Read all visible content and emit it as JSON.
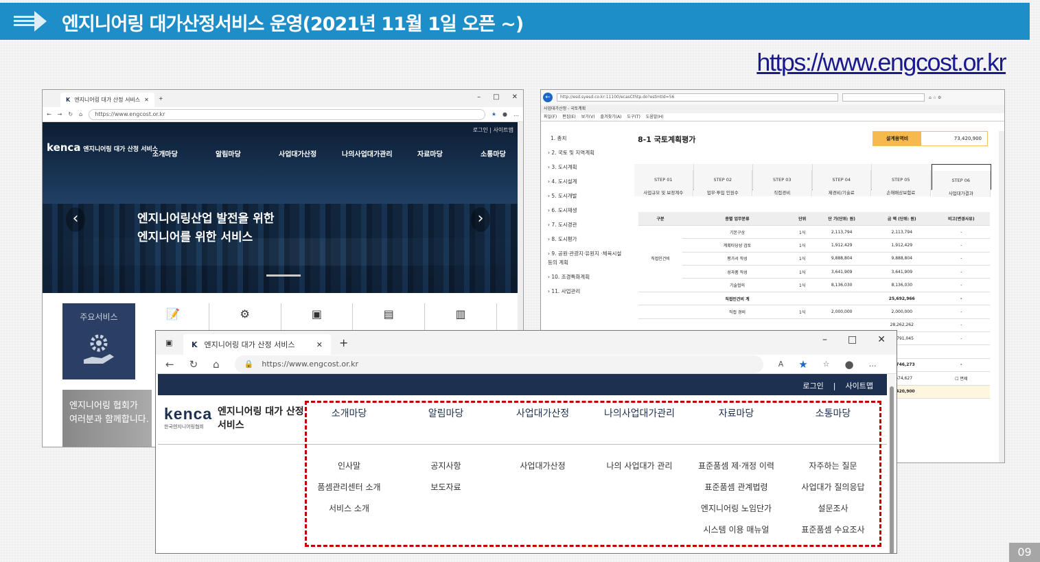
{
  "slide": {
    "title": "엔지니어링 대가산정서비스 운영(2021년 11월 1일 오픈 ~)",
    "url": "https://www.engcost.or.kr",
    "page_number": "09"
  },
  "win1": {
    "tab_title": "엔지니어링 대가 산정 서비스",
    "address": "https://www.engcost.or.kr",
    "login": "로그인 | 사이트맵",
    "logo": "kenca",
    "logo_name": "엔지니어링 대가 산정 서비스",
    "menu": [
      "소개마당",
      "알림마당",
      "사업대가산정",
      "나의사업대가관리",
      "자료마당",
      "소통마당"
    ],
    "slogan_1": "엔지니어링산업 발전을 위한",
    "slogan_2": "엔지니어를 위한 서비스",
    "service_title": "주요서비스",
    "promo_1": "엔지니어링 협회가",
    "promo_2": "여러분과 함께합니다."
  },
  "win2": {
    "address": "http://esd.syesd.co.kr:11100/ecasCthtp.do?estmtId=56",
    "tab_title": "사업대가산정 - 국토계획",
    "menubar": [
      "파일(F)",
      "편집(E)",
      "보기(V)",
      "즐겨찾기(A)",
      "도구(T)",
      "도움말(H)"
    ],
    "nav": [
      "1. 총치",
      "2. 국토 및 지역계획",
      "3. 도시계획",
      "4. 도시설계",
      "5. 도시개발",
      "6. 도시재생",
      "7. 도시경관",
      "8. 도시평가",
      "9. 공원·관광지·유원지 ·체육시설 등의 계획",
      "10. 조경특화계획",
      "11. 사업관리"
    ],
    "page_title": "8-1 국토계획평가",
    "sum_label": "설계용역비",
    "sum_value": "73,420,900",
    "steps": [
      {
        "top": "STEP 01",
        "bottom": "사업규모 및 보정계수"
      },
      {
        "top": "STEP 02",
        "bottom": "업무·투입 인원수"
      },
      {
        "top": "STEP 03",
        "bottom": "직접경비"
      },
      {
        "top": "STEP 04",
        "bottom": "제경비/기술료"
      },
      {
        "top": "STEP 05",
        "bottom": "손해배상보험료"
      },
      {
        "top": "STEP 06",
        "bottom": "사업대가결과"
      }
    ],
    "table_head": [
      "구분",
      "종별 업무분류",
      "단위",
      "단 가(단위: 원)",
      "금 액 (단위: 원)",
      "비고(변경사유)"
    ],
    "group_label": "직접인건비",
    "rows": [
      {
        "name": "기본구상",
        "unit": "1식",
        "price": "2,113,794",
        "amount": "2,113,794",
        "note": "-"
      },
      {
        "name": "계획타당성 검토",
        "unit": "1식",
        "price": "1,912,429",
        "amount": "1,912,429",
        "note": "-"
      },
      {
        "name": "평가서 작성",
        "unit": "1식",
        "price": "9,888,804",
        "amount": "9,888,804",
        "note": "-"
      },
      {
        "name": "성과품 작성",
        "unit": "1식",
        "price": "3,641,909",
        "amount": "3,641,909",
        "note": "-"
      },
      {
        "name": "기술협의",
        "unit": "1식",
        "price": "8,136,030",
        "amount": "8,136,030",
        "note": "-"
      }
    ],
    "subtotal_label": "직접인건비 계",
    "subtotal": "25,692,966",
    "row_direct": {
      "name": "직접 경비",
      "unit": "1식",
      "price": "2,000,000",
      "amount": "2,000,000",
      "note": "-"
    },
    "extra_amounts": [
      "28,262,262",
      "10,791,045",
      "66,746,273",
      "6,674,627",
      "73,420,900"
    ],
    "exempt": "면제"
  },
  "win3": {
    "tab_title": "엔지니어링 대가 산정 서비스",
    "address": "https://www.engcost.or.kr",
    "login": "로그인",
    "sitemap": "사이트맵",
    "logo": "kenca",
    "logo_sub": "한국엔지니어링협회",
    "logo_name": "엔지니어링 대가 산정 서비스",
    "menu": [
      "소개마당",
      "알림마당",
      "사업대가산정",
      "나의사업대가관리",
      "자료마당",
      "소통마당"
    ],
    "submenu": [
      [
        "인사말",
        "품셈관리센터 소개",
        "서비스 소개"
      ],
      [
        "공지사항",
        "보도자료"
      ],
      [
        "사업대가산정"
      ],
      [
        "나의 사업대가 관리"
      ],
      [
        "표준품셈 제·개정 이력",
        "표준품셈 관계법령",
        "엔지니어링 노임단가",
        "시스템 이용 매뉴얼"
      ],
      [
        "자주하는 질문",
        "사업대가 질의응답",
        "설문조사",
        "표준품셈 수요조사"
      ]
    ]
  }
}
